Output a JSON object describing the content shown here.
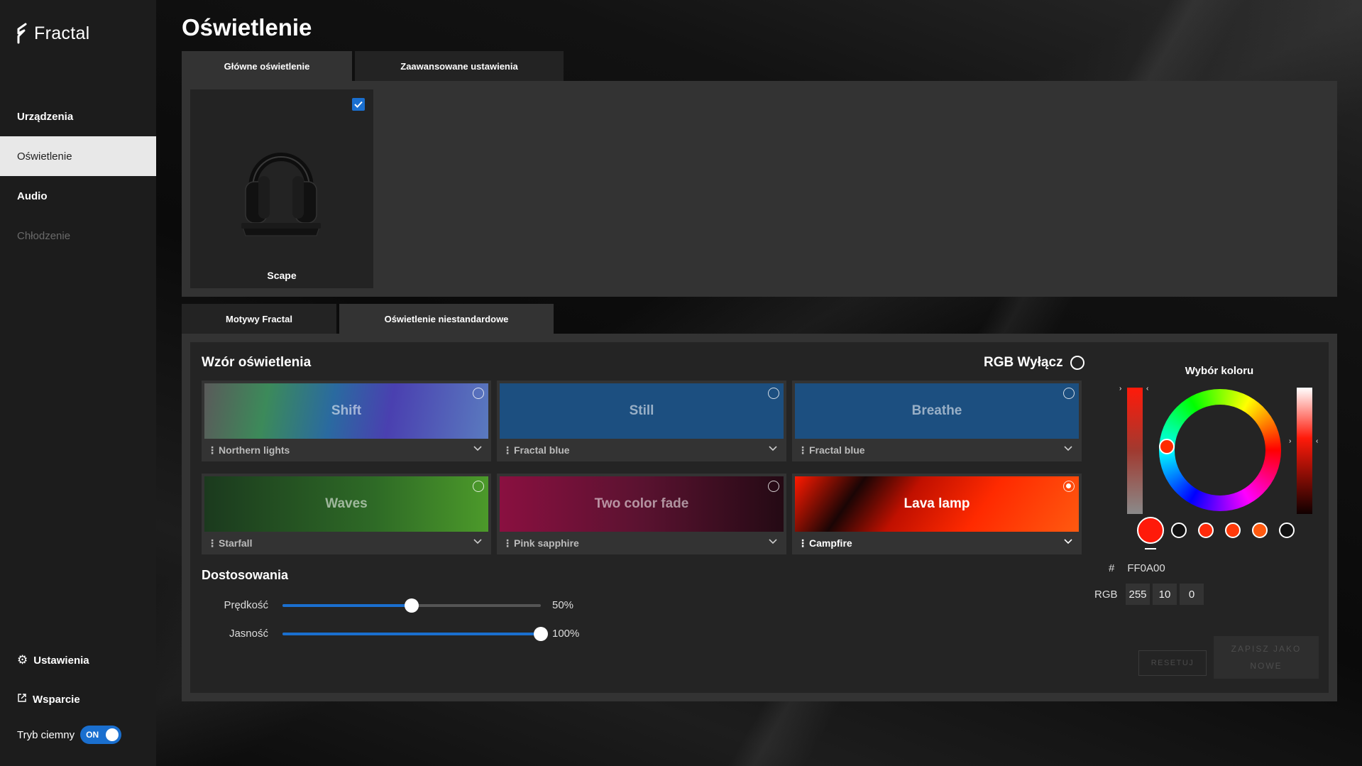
{
  "app": {
    "brand": "Fractal"
  },
  "sidebar": {
    "items": [
      {
        "label": "Urządzenia",
        "state": "normal"
      },
      {
        "label": "Oświetlenie",
        "state": "active"
      },
      {
        "label": "Audio",
        "state": "normal"
      },
      {
        "label": "Chłodzenie",
        "state": "disabled"
      }
    ],
    "settings": "Ustawienia",
    "support": "Wsparcie",
    "dark_mode_label": "Tryb ciemny",
    "dark_mode_value": "ON"
  },
  "page": {
    "title": "Oświetlenie"
  },
  "top_tabs": [
    {
      "label": "Główne oświetlenie",
      "active": true
    },
    {
      "label": "Zaawansowane ustawienia",
      "active": false
    }
  ],
  "device": {
    "name": "Scape",
    "checked": true
  },
  "bottom_tabs": [
    {
      "label": "Motywy Fractal",
      "active": false
    },
    {
      "label": "Oświetlenie niestandardowe",
      "active": true
    }
  ],
  "pattern_section": {
    "title": "Wzór oświetlenia",
    "rgb_off_label": "RGB Wyłącz",
    "patterns": [
      {
        "name": "Shift",
        "preset": "Northern lights",
        "selected": false
      },
      {
        "name": "Still",
        "preset": "Fractal blue",
        "selected": false
      },
      {
        "name": "Breathe",
        "preset": "Fractal blue",
        "selected": false
      },
      {
        "name": "Waves",
        "preset": "Starfall",
        "selected": false
      },
      {
        "name": "Two color fade",
        "preset": "Pink sapphire",
        "selected": false
      },
      {
        "name": "Lava lamp",
        "preset": "Campfire",
        "selected": true
      }
    ]
  },
  "customization": {
    "title": "Dostosowania",
    "speed": {
      "label": "Prędkość",
      "value": 50,
      "display": "50%"
    },
    "brightness": {
      "label": "Jasność",
      "value": 100,
      "display": "100%"
    }
  },
  "color_picker": {
    "title": "Wybór koloru",
    "hex_label": "#",
    "hex_value": "FF0A00",
    "rgb_label": "RGB",
    "r": "255",
    "g": "10",
    "b": "0",
    "presets": [
      "#ff1a0a",
      "#111111",
      "#ff2a0a",
      "#ff3a0a",
      "#ff5a10",
      "#111111"
    ],
    "reset_label": "RESETUJ",
    "save_label": "ZAPISZ JAKO NOWE"
  }
}
